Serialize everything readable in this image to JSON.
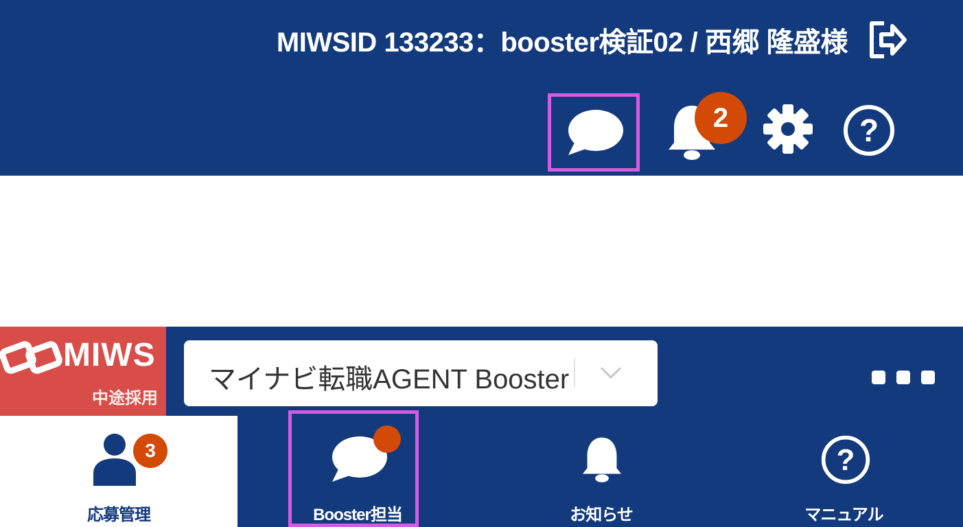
{
  "header": {
    "user_info": "MIWSID 133233：booster検証02 / 西郷 隆盛様",
    "notification_count": "2",
    "icons": [
      "logout-icon",
      "chat-icon",
      "bell-icon",
      "gear-icon",
      "help-icon"
    ]
  },
  "app_bar": {
    "logo_text": "MIWS",
    "logo_subtext": "中途採用",
    "service_select_value": "マイナビ転職AGENT Booster",
    "nav": [
      {
        "label": "応募管理",
        "icon": "person-icon",
        "badge": "3"
      },
      {
        "label": "Booster担当",
        "icon": "chat-icon"
      },
      {
        "label": "お知らせ",
        "icon": "bell-icon"
      },
      {
        "label": "マニュアル",
        "icon": "help-icon"
      }
    ]
  },
  "colors": {
    "header_bg": "#133a7c",
    "badge": "#d24a06",
    "logo_bg": "#d84d47",
    "highlight": "#d45ce2"
  }
}
